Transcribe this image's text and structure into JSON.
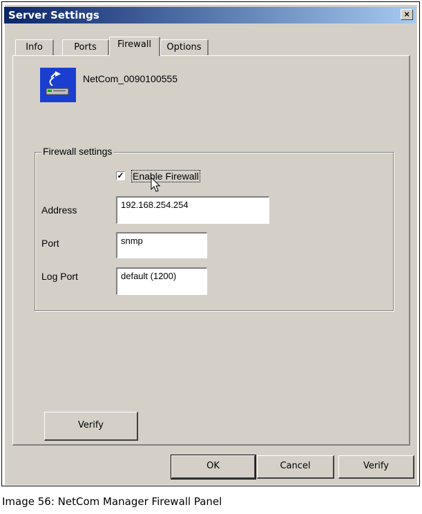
{
  "window": {
    "title": "Server Settings",
    "close_label": "×"
  },
  "tabs": [
    {
      "label": "Info"
    },
    {
      "label": "Ports"
    },
    {
      "label": "Firewall",
      "active": true
    },
    {
      "label": "Options"
    }
  ],
  "device": {
    "name": "NetCom_0090100555",
    "icon": "network-device-icon"
  },
  "firewall": {
    "group_label": "Firewall settings",
    "enable_label": "Enable Firewall",
    "enabled": true,
    "address_label": "Address",
    "address_value": "192.168.254.254",
    "port_label": "Port",
    "port_value": "snmp",
    "logport_label": "Log Port",
    "logport_value": "default (1200)"
  },
  "panel_buttons": {
    "verify": "Verify"
  },
  "dialog_buttons": {
    "ok": "OK",
    "cancel": "Cancel",
    "verify": "Verify"
  },
  "caption": "Image 56: NetCom Manager Firewall Panel",
  "colors": {
    "titlebar_start": "#0a246a",
    "titlebar_end": "#a6caf0",
    "face": "#d4d0c8",
    "icon_bg": "#1a3fd0"
  }
}
